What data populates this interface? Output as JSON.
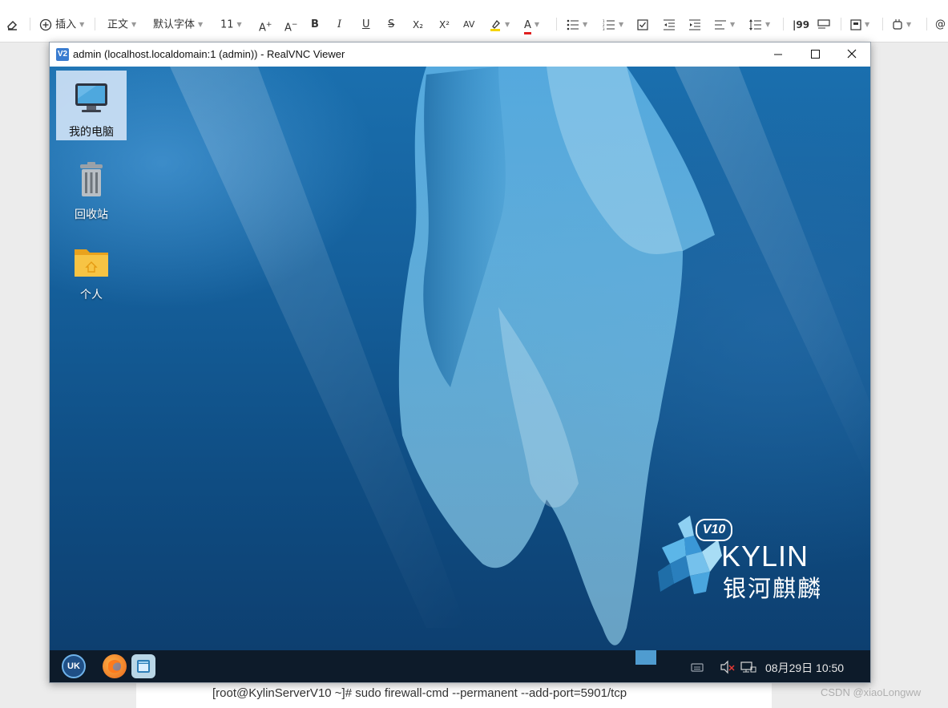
{
  "editor_toolbar": {
    "insert_label": "插入",
    "style_label": "正文",
    "font_label": "默认字体",
    "size_label": "11",
    "icons": [
      "eraser-icon",
      "insert-icon",
      "font-grow-icon",
      "font-shrink-icon",
      "bold-icon",
      "italic-icon",
      "underline-icon",
      "strikethrough-icon",
      "subscript-icon",
      "superscript-icon",
      "letter-spacing-icon",
      "highlight-icon",
      "font-color-icon",
      "bullet-list-icon",
      "numbered-list-icon",
      "checklist-icon",
      "outdent-icon",
      "indent-icon",
      "align-icon",
      "line-spacing-icon",
      "quote-icon",
      "block-icon",
      "template-icon",
      "plugin-icon",
      "mention-icon"
    ],
    "highlight_color": "#f5d400",
    "font_color": "#e02020",
    "bold_glyph": "B",
    "italic_glyph": "I",
    "underline_glyph": "U",
    "strike_glyph": "S",
    "sub_glyph": "X₂",
    "sup_glyph": "X²",
    "av_glyph": "AV",
    "a_glyph": "A",
    "quote_glyph": "|99",
    "at_glyph": "@"
  },
  "document": {
    "command_line": "[root@KylinServerV10 ~]# sudo firewall-cmd --permanent --add-port=5901/tcp",
    "watermark": "CSDN @xiaoLongww"
  },
  "vnc_window": {
    "title": "admin (localhost.localdomain:1 (admin)) - RealVNC Viewer",
    "logo_letters": "V2"
  },
  "desktop": {
    "icons": [
      {
        "label": "我的电脑",
        "icon": "computer-icon",
        "selected": true
      },
      {
        "label": "回收站",
        "icon": "trash-icon",
        "selected": false
      },
      {
        "label": "个人",
        "icon": "home-folder-icon",
        "selected": false
      }
    ],
    "brand": {
      "version": "V10",
      "name": "KYLIN",
      "name_cn": "银河麒麟"
    }
  },
  "taskbar": {
    "start_label": "UK",
    "apps": [
      "start-menu-icon",
      "firefox-icon",
      "file-manager-icon"
    ],
    "tray": [
      "keyboard-icon",
      "volume-muted-icon",
      "network-icon"
    ],
    "clock": "08月29日 10:50"
  },
  "colors": {
    "taskbar_bg": "#0d1b2a",
    "desktop_blue": "#15609c",
    "selection": "#cde1f5"
  }
}
